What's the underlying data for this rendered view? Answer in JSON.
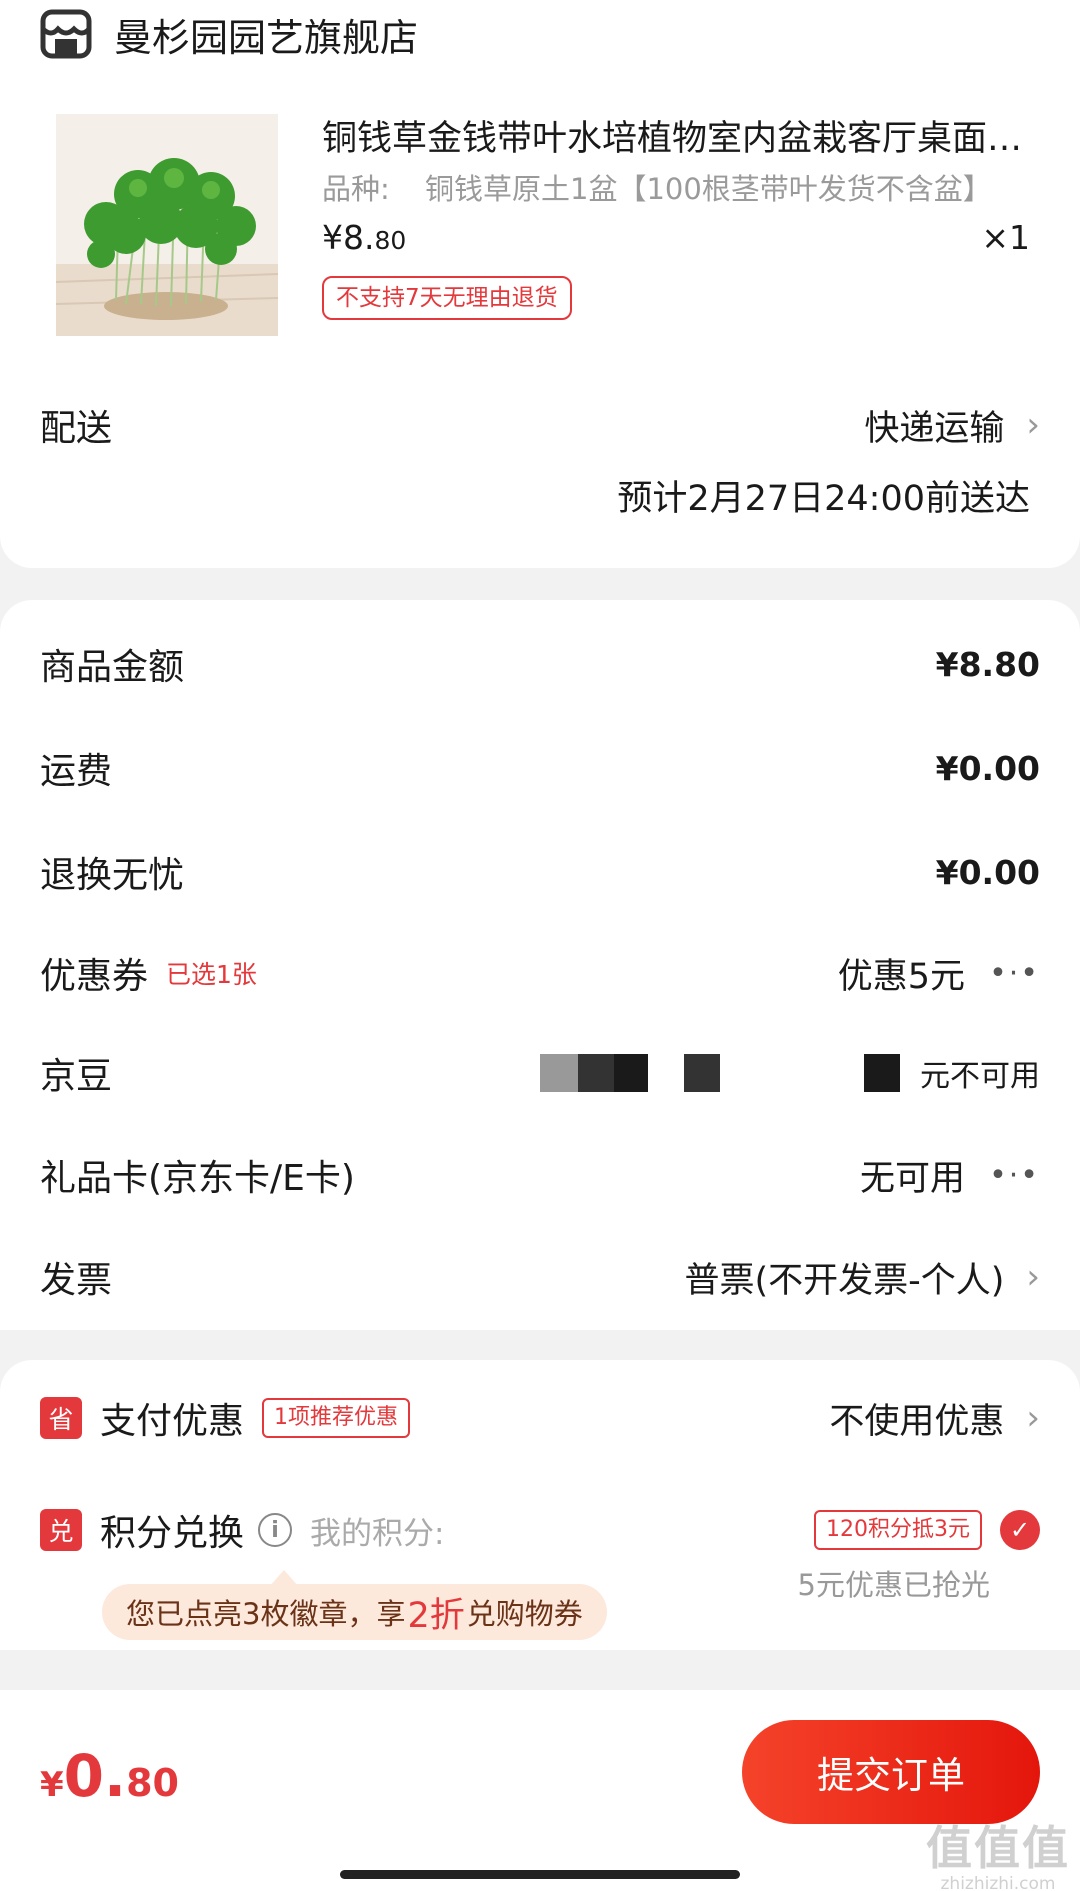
{
  "shop": {
    "name": "曼杉园园艺旗舰店",
    "icon": "storefront-icon"
  },
  "product": {
    "title": "铜钱草金钱带叶水培植物室内盆栽客厅桌面绿植",
    "spec_label": "品种:",
    "spec_value": "铜钱草原土1盆【100根茎带叶发货不含盆】",
    "price_currency": "¥",
    "price_int": "8.",
    "price_dec": "80",
    "quantity": "×1",
    "return_policy": "不支持7天无理由退货"
  },
  "delivery": {
    "label": "配送",
    "method": "快递运输",
    "eta": "预计2月27日24:00前送达"
  },
  "fees": {
    "goods_label": "商品金额",
    "goods_amount": "¥8.80",
    "shipping_label": "运费",
    "shipping_amount": "¥0.00",
    "worry_free_label": "退换无忧",
    "worry_free_amount": "¥0.00",
    "coupon_label": "优惠券",
    "coupon_selected": "已选1张",
    "coupon_value": "优惠5元",
    "jingdou_label": "京豆",
    "jingdou_value": "元不可用",
    "giftcard_label": "礼品卡(京东卡/E卡)",
    "giftcard_value": "无可用",
    "invoice_label": "发票",
    "invoice_value": "普票(不开发票-个人)"
  },
  "pay": {
    "discount_badge": "省",
    "discount_label": "支付优惠",
    "discount_tag": "1项推荐优惠",
    "discount_value": "不使用优惠",
    "points_badge": "兑",
    "points_label": "积分兑换",
    "points_hint": "我的积分:",
    "points_tag": "120积分抵3元",
    "sold_out": "5元优惠已抢光",
    "promo_prefix": "您已点亮3枚徽章，享",
    "promo_highlight": "2折",
    "promo_suffix": "兑购物券"
  },
  "footer": {
    "total_currency": "¥",
    "total_int": "0.",
    "total_dec": "80",
    "submit_label": "提交订单",
    "watermark_big": "值值值",
    "watermark_small": "zhizhizhi.com"
  },
  "colors": {
    "accent": "#e4393c",
    "background": "#f2f2f2"
  }
}
